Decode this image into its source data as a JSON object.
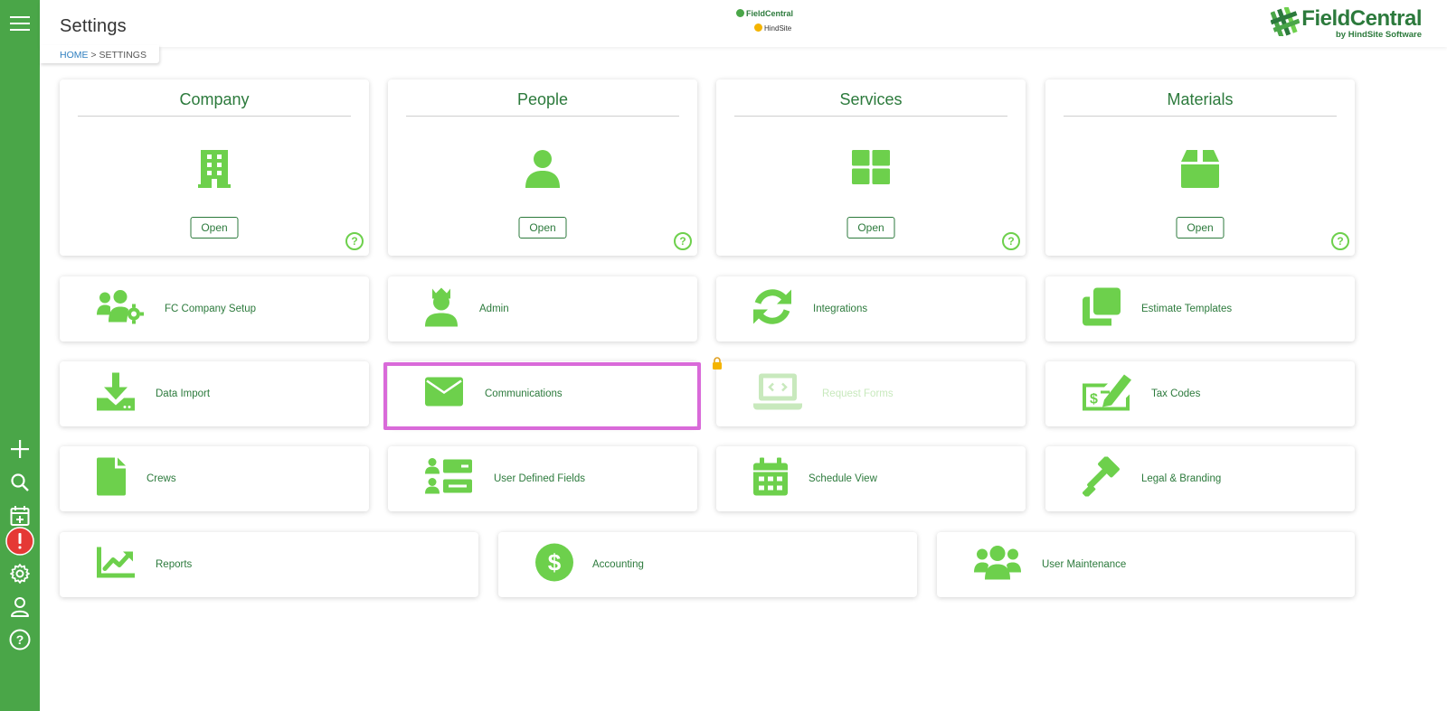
{
  "header": {
    "title": "Settings",
    "breadcrumb_home": "HOME",
    "breadcrumb_sep": " > ",
    "breadcrumb_current": "SETTINGS",
    "center_logo_line1": "FieldCentral",
    "center_logo_line2": "HindSite",
    "brand_name": "FieldCentral",
    "brand_sub": "by HindSite Software"
  },
  "sidebar": {
    "items": [
      {
        "icon": "menu-icon"
      },
      {
        "icon": "plus-icon"
      },
      {
        "icon": "search-icon"
      },
      {
        "icon": "calendar-add-icon"
      },
      {
        "icon": "alert-icon"
      },
      {
        "icon": "gear-icon"
      },
      {
        "icon": "user-icon"
      },
      {
        "icon": "help-icon"
      }
    ]
  },
  "big_cards": [
    {
      "title": "Company",
      "button": "Open",
      "help": "?",
      "icon": "building-icon"
    },
    {
      "title": "People",
      "button": "Open",
      "help": "?",
      "icon": "person-icon"
    },
    {
      "title": "Services",
      "button": "Open",
      "help": "?",
      "icon": "grid-icon"
    },
    {
      "title": "Materials",
      "button": "Open",
      "help": "?",
      "icon": "box-icon"
    }
  ],
  "tiles": [
    {
      "label": "FC Company Setup",
      "icon": "users-gear-icon"
    },
    {
      "label": "Admin",
      "icon": "admin-icon"
    },
    {
      "label": "Integrations",
      "icon": "sync-icon"
    },
    {
      "label": "Estimate Templates",
      "icon": "copy-icon"
    },
    {
      "label": "Data Import",
      "icon": "download-icon"
    },
    {
      "label": "Communications",
      "icon": "envelope-icon"
    },
    {
      "label": "Request Forms",
      "icon": "laptop-code-icon",
      "disabled": true
    },
    {
      "label": "Tax Codes",
      "icon": "money-check-icon"
    },
    {
      "label": "Crews",
      "icon": "file-icon"
    },
    {
      "label": "User Defined Fields",
      "icon": "user-list-icon"
    },
    {
      "label": "Schedule View",
      "icon": "calendar-icon"
    },
    {
      "label": "Legal & Branding",
      "icon": "gavel-icon"
    },
    {
      "label": "Reports",
      "icon": "chart-line-icon"
    },
    {
      "label": "Accounting",
      "icon": "dollar-circle-icon"
    },
    {
      "label": "User Maintenance",
      "icon": "users-icon"
    }
  ],
  "colors": {
    "sidebar": "#4aa648",
    "accent": "#6dd04c",
    "text_green": "#2c7a3c",
    "highlight": "#d96ad9",
    "alert": "#e53935"
  }
}
